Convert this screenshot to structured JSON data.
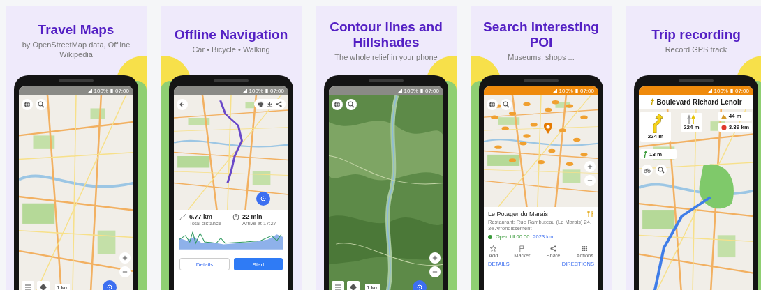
{
  "slides": [
    {
      "title": "Travel Maps",
      "subtitle": "by OpenStreetMap data, Offline Wikipedia",
      "screen": {
        "kind": "browse",
        "map": {
          "kind": "street"
        },
        "status": {
          "highlighted": false,
          "battery": "100%",
          "time": "07:00"
        },
        "scale": "1 km"
      }
    },
    {
      "title": "Offline Navigation",
      "subtitle": "Car • Bicycle • Walking",
      "screen": {
        "kind": "route",
        "map": {
          "kind": "street"
        },
        "status": {
          "highlighted": false,
          "battery": "100%",
          "time": "07:00"
        },
        "distance": "6.77 km",
        "distance_label": "Total distance",
        "duration": "22 min",
        "arrival": "Arrive at 17:27",
        "buttons": [
          {
            "kind": "outline",
            "label": "Details"
          },
          {
            "kind": "filled",
            "label": "Start"
          }
        ]
      }
    },
    {
      "title": "Contour lines and Hillshades",
      "subtitle": "The whole relief in your phone",
      "screen": {
        "kind": "browse",
        "map": {
          "kind": "terrain"
        },
        "status": {
          "highlighted": false,
          "battery": "100%",
          "time": "07:00"
        },
        "scale": "1 km"
      }
    },
    {
      "title": "Search interesting POI",
      "subtitle": "Museums, shops ...",
      "screen": {
        "kind": "poi",
        "map": {
          "kind": "street"
        },
        "status": {
          "highlighted": true,
          "battery": "100%",
          "time": "07:00"
        },
        "place": {
          "name": "Le Potager du Marais",
          "address": "Restaurant: Rue Rambuteau (Le Marais) 24, 3e Arrondissement",
          "hours": "Open till 00:00",
          "distance": "2023 km"
        },
        "actions": [
          {
            "kind": "star",
            "label": "Add"
          },
          {
            "kind": "flag",
            "label": "Marker"
          },
          {
            "kind": "share",
            "label": "Share"
          },
          {
            "kind": "grid",
            "label": "Actions"
          }
        ],
        "links": [
          "DETAILS",
          "DIRECTIONS"
        ]
      }
    },
    {
      "title": "Trip recording",
      "subtitle": "Record GPS track",
      "screen": {
        "kind": "guidance",
        "map": {
          "kind": "street"
        },
        "status": {
          "highlighted": true,
          "battery": "100%",
          "time": "07:00"
        },
        "street": "Boulevard Richard Lenoir",
        "turn_distance": "224 m",
        "next_distance": "13 m",
        "lane_distance": "224 m",
        "info": [
          {
            "kind": "altitude",
            "value": "44 m"
          },
          {
            "kind": "destination",
            "value": "3.39 km"
          }
        ]
      }
    }
  ]
}
